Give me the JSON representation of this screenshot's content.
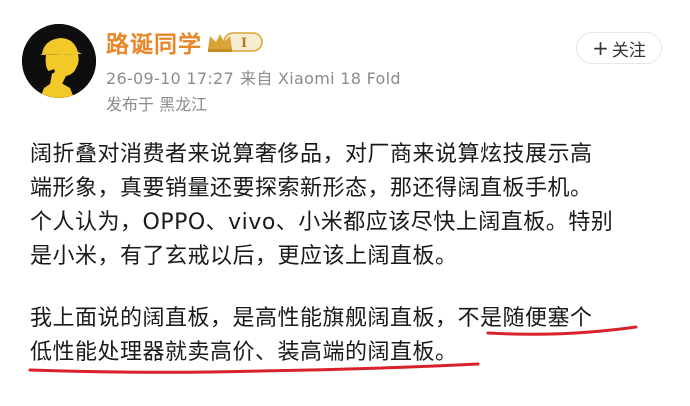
{
  "author": {
    "name": "路诞同学",
    "badge_label": "Ⅰ"
  },
  "meta": {
    "timestamp": "26-09-10 17:27",
    "device": "来自 Xiaomi 18 Fold",
    "location": "发布于 黑龙江"
  },
  "follow": {
    "plus": "+",
    "label": "关注"
  },
  "post": {
    "lines": [
      "阔折叠对消费者来说算奢侈品，对厂商来说算炫技展示高",
      "端形象，真要销量还要探索新形态，那还得阔直板手机。",
      "个人认为，OPPO、vivo、小米都应该尽快上阔直板。特别",
      "是小米，有了玄戒以后，更应该上阔直板。",
      "我上面说的阔直板，是高性能旗舰阔直板，不是随便塞个",
      "低性能处理器就卖高价、装高端的阔直板。"
    ]
  },
  "colors": {
    "username": "#e8862a",
    "meta": "#8b8b8b",
    "underline": "#d9212b",
    "badge": "#d8a437"
  },
  "icons": {
    "avatar": "detective-silhouette-icon",
    "badge": "crown-level-icon",
    "follow": "plus-icon"
  }
}
